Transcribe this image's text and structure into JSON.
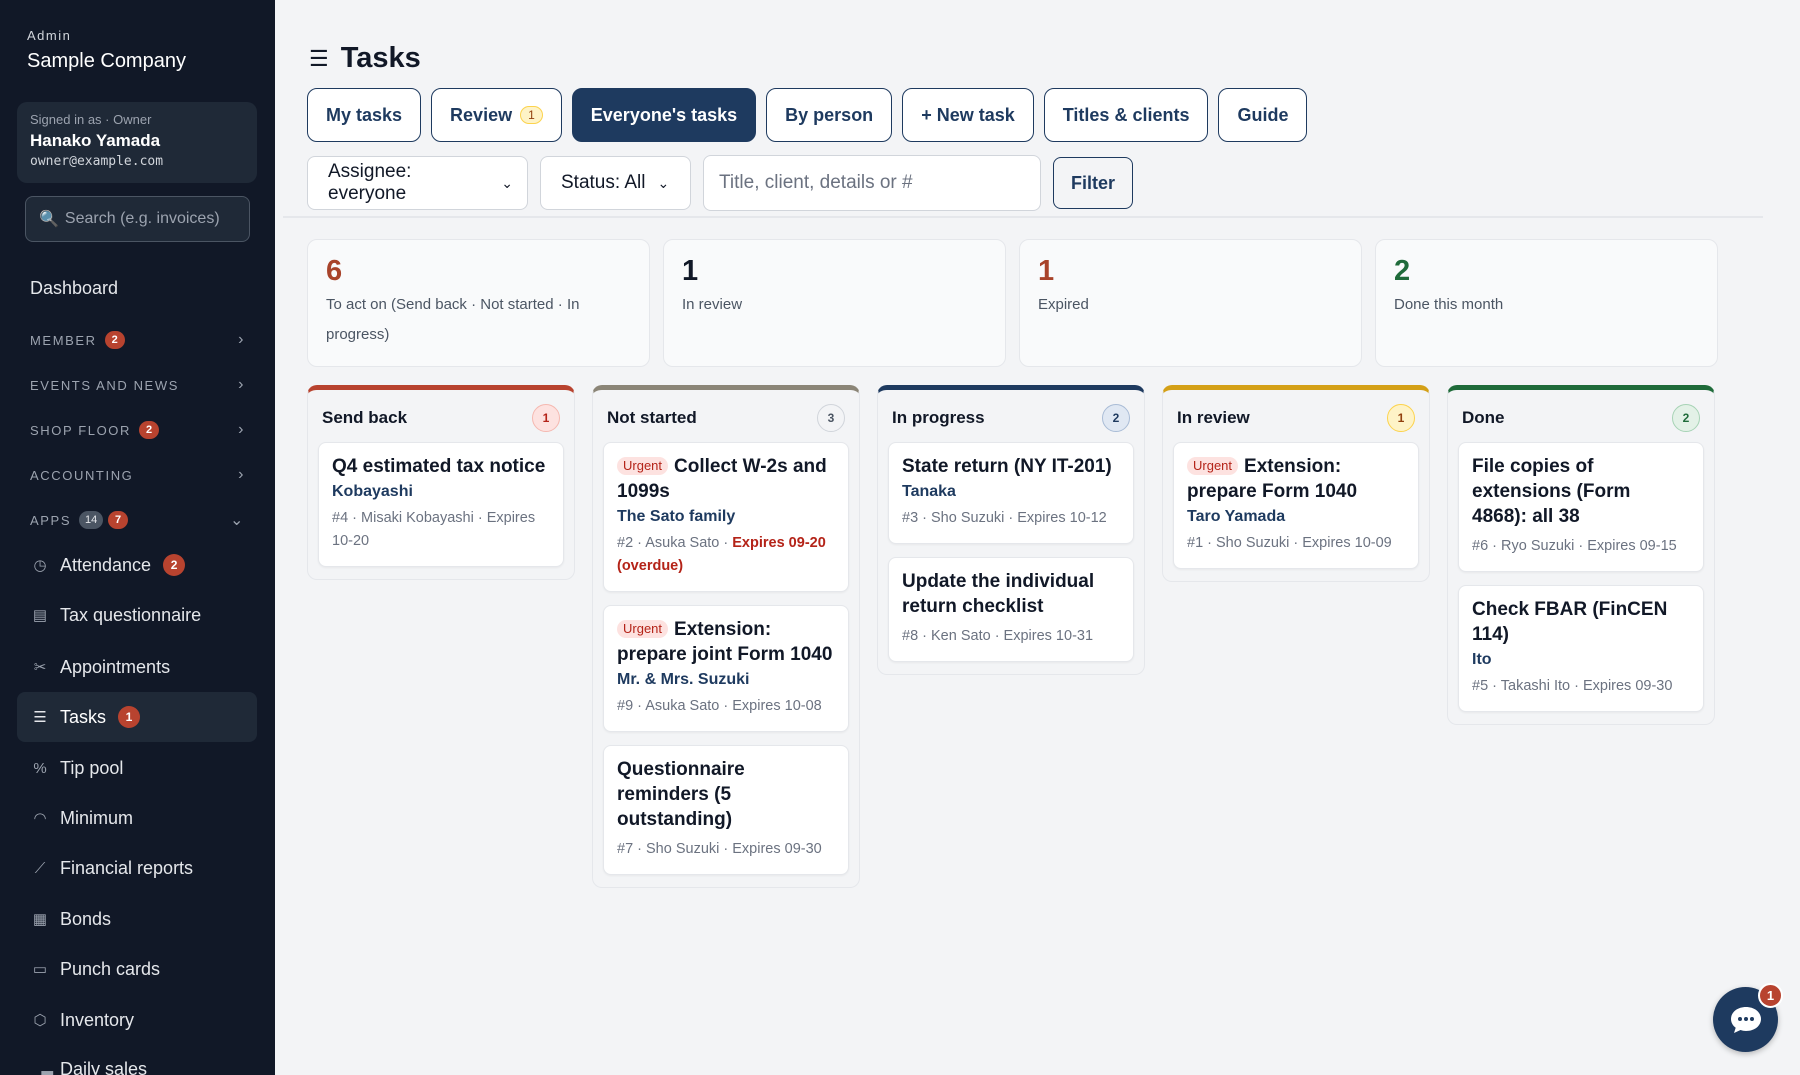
{
  "sidebar": {
    "brand_small": "Admin",
    "brand_name": "Sample Company",
    "user": {
      "role": "Signed in as · Owner",
      "name": "Hanako Yamada",
      "email": "owner@example.com"
    },
    "search_placeholder": "Search (e.g. invoices)",
    "dashboard": "Dashboard",
    "sections": [
      {
        "label": "MEMBER",
        "badge": "2"
      },
      {
        "label": "EVENTS AND NEWS"
      },
      {
        "label": "SHOP FLOOR",
        "badge": "2"
      },
      {
        "label": "ACCOUNTING"
      },
      {
        "label": "APPS",
        "count": "14",
        "badge": "7"
      }
    ],
    "items": [
      {
        "label": "Attendance",
        "icon": "clock-icon",
        "badge": "2"
      },
      {
        "label": "Tax questionnaire",
        "icon": "document-icon"
      },
      {
        "label": "Appointments",
        "icon": "scissors-icon"
      },
      {
        "label": "Tasks",
        "icon": "checklist-icon",
        "badge": "1"
      },
      {
        "label": "Tip pool",
        "icon": "percent-icon"
      },
      {
        "label": "Minimum",
        "icon": "gauge-icon"
      },
      {
        "label": "Financial reports",
        "icon": "chart-icon"
      },
      {
        "label": "Bonds",
        "icon": "receipt-icon"
      },
      {
        "label": "Punch cards",
        "icon": "card-icon"
      },
      {
        "label": "Inventory",
        "icon": "box-icon"
      },
      {
        "label": "Daily sales",
        "icon": "bar-chart-icon"
      }
    ]
  },
  "main": {
    "title": "Tasks",
    "tabs": [
      {
        "label": "My tasks"
      },
      {
        "label": "Review",
        "count": "1"
      },
      {
        "label": "Everyone's tasks",
        "active": true
      },
      {
        "label": "By person"
      },
      {
        "label": "+ New task"
      },
      {
        "label": "Titles & clients"
      },
      {
        "label": "Guide"
      }
    ],
    "filters": {
      "assignee": "Assignee: everyone",
      "status": "Status: All",
      "search_placeholder": "Title, client, details or #",
      "filter_button": "Filter"
    },
    "stats": [
      {
        "value": "6",
        "label": "To act on (Send back · Not started · In progress)",
        "color": "#a8432a"
      },
      {
        "value": "1",
        "label": "In review",
        "color": "#111827"
      },
      {
        "value": "1",
        "label": "Expired",
        "color": "#a8432a"
      },
      {
        "value": "2",
        "label": "Done this month",
        "color": "#1f6b3a"
      }
    ],
    "columns": [
      {
        "title": "Send back",
        "count": "1",
        "accent": "#b8432f",
        "cards": [
          {
            "title": "Q4 estimated tax notice",
            "client": "Kobayashi",
            "meta": "#4 · Misaki Kobayashi · Expires 10-20"
          }
        ]
      },
      {
        "title": "Not started",
        "count": "3",
        "accent": "#8b8577",
        "cards": [
          {
            "urgent": "Urgent",
            "title": "Collect W-2s and 1099s",
            "client": "The Sato family",
            "meta": "#2 · Asuka Sato · ",
            "overdue": "Expires 09-20 (overdue)"
          },
          {
            "urgent": "Urgent",
            "title": "Extension: prepare joint Form 1040",
            "client": "Mr. & Mrs. Suzuki",
            "meta": "#9 · Asuka Sato · Expires 10-08"
          },
          {
            "title": "Questionnaire reminders (5 outstanding)",
            "meta": "#7 · Sho Suzuki · Expires 09-30"
          }
        ]
      },
      {
        "title": "In progress",
        "count": "2",
        "accent": "#1e3a5f",
        "cards": [
          {
            "title": "State return (NY IT-201)",
            "client": "Tanaka",
            "meta": "#3 · Sho Suzuki · Expires 10-12"
          },
          {
            "title": "Update the individual return checklist",
            "meta": "#8 · Ken Sato · Expires 10-31"
          }
        ]
      },
      {
        "title": "In review",
        "count": "1",
        "accent": "#d4a017",
        "cards": [
          {
            "urgent": "Urgent",
            "title": "Extension: prepare Form 1040",
            "client": "Taro Yamada",
            "meta": "#1 · Sho Suzuki · Expires 10-09"
          }
        ]
      },
      {
        "title": "Done",
        "count": "2",
        "accent": "#1f6b3a",
        "cards": [
          {
            "title": "File copies of extensions (Form 4868): all 38",
            "meta": "#6 · Ryo Suzuki · Expires 09-15"
          },
          {
            "title": "Check FBAR (FinCEN 114)",
            "client": "Ito",
            "meta": "#5 · Takashi Ito · Expires 09-30"
          }
        ]
      }
    ]
  },
  "chat": {
    "badge": "1"
  }
}
